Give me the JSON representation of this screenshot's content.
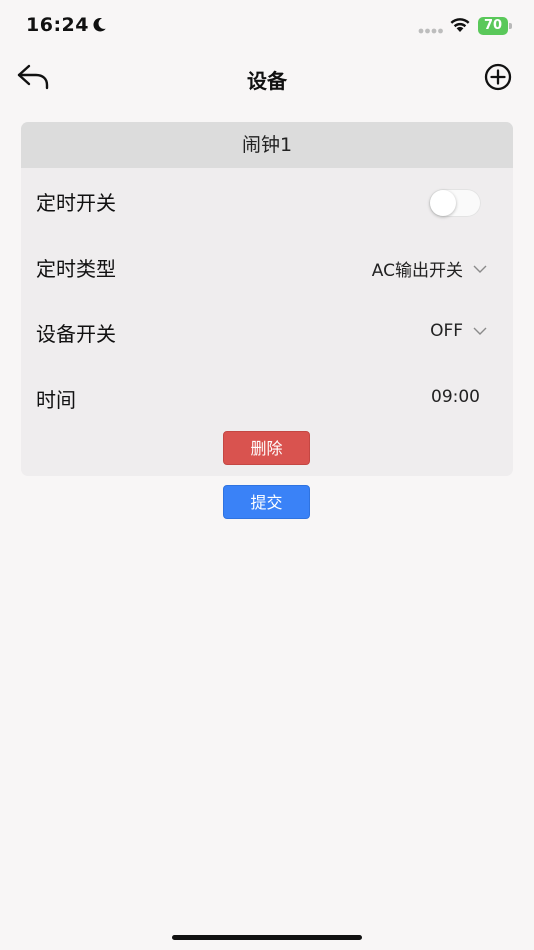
{
  "status_bar": {
    "time": "16:24",
    "battery": "70",
    "battery_color": "#5ac85a"
  },
  "nav": {
    "title": "设备",
    "back_icon": "back-arrow-icon",
    "add_icon": "plus-circle-icon"
  },
  "card": {
    "title": "闹钟1",
    "rows": [
      {
        "label": "定时开关",
        "type": "toggle",
        "value": false
      },
      {
        "label": "定时类型",
        "type": "select",
        "value": "AC输出开关"
      },
      {
        "label": "设备开关",
        "type": "select",
        "value": "OFF"
      },
      {
        "label": "时间",
        "type": "time",
        "value": "09:00"
      }
    ],
    "delete_label": "删除"
  },
  "submit_label": "提交",
  "colors": {
    "delete": "#d9534f",
    "submit": "#3a82f7",
    "background": "#f8f6f6",
    "card": "#efedee",
    "card_header": "#dcdcdc"
  }
}
